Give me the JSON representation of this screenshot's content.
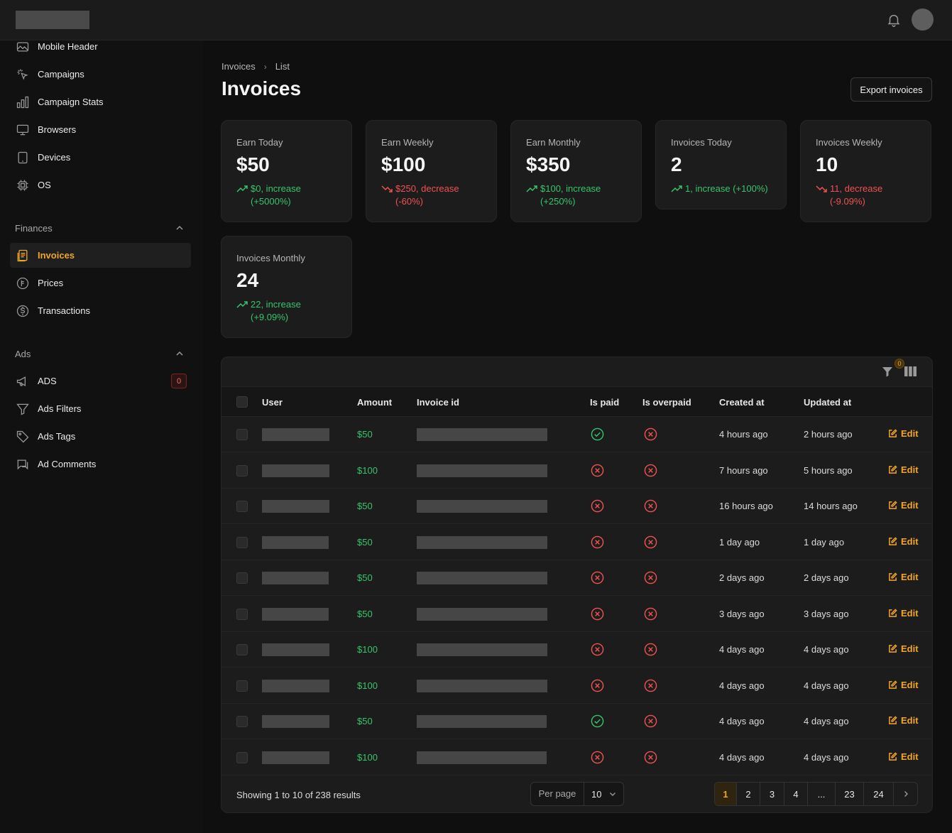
{
  "header": {
    "logo_alt": "",
    "bell_icon": "bell-icon",
    "avatar": "avatar"
  },
  "sidebar": {
    "items_top": [
      {
        "label": "Mobile Header",
        "icon": "image-icon"
      },
      {
        "label": "Campaigns",
        "icon": "pointer-click-icon"
      },
      {
        "label": "Campaign Stats",
        "icon": "bar-chart-icon"
      },
      {
        "label": "Browsers",
        "icon": "monitor-icon"
      },
      {
        "label": "Devices",
        "icon": "tablet-icon"
      },
      {
        "label": "OS",
        "icon": "chip-icon"
      }
    ],
    "finances": {
      "label": "Finances",
      "items": [
        {
          "label": "Invoices",
          "icon": "invoice-icon",
          "active": true
        },
        {
          "label": "Prices",
          "icon": "price-icon"
        },
        {
          "label": "Transactions",
          "icon": "dollar-icon"
        }
      ]
    },
    "ads": {
      "label": "Ads",
      "items": [
        {
          "label": "ADS",
          "icon": "megaphone-icon",
          "badge": "0"
        },
        {
          "label": "Ads Filters",
          "icon": "filter-icon"
        },
        {
          "label": "Ads Tags",
          "icon": "tag-icon"
        },
        {
          "label": "Ad Comments",
          "icon": "comment-icon"
        }
      ]
    }
  },
  "breadcrumb": {
    "root": "Invoices",
    "sep": "›",
    "current": "List"
  },
  "page": {
    "title": "Invoices",
    "export_label": "Export invoices"
  },
  "stats": [
    {
      "label": "Earn Today",
      "value": "$50",
      "trend": "up",
      "text": "$0, increase (+5000%)"
    },
    {
      "label": "Earn Weekly",
      "value": "$100",
      "trend": "down",
      "text": "$250, decrease (-60%)"
    },
    {
      "label": "Earn Monthly",
      "value": "$350",
      "trend": "up",
      "text": "$100, increase (+250%)"
    },
    {
      "label": "Invoices Today",
      "value": "2",
      "trend": "up",
      "text": "1, increase (+100%)"
    },
    {
      "label": "Invoices Weekly",
      "value": "10",
      "trend": "down",
      "text": "11, decrease (-9.09%)"
    },
    {
      "label": "Invoices Monthly",
      "value": "24",
      "trend": "up",
      "text": "22, increase (+9.09%)"
    }
  ],
  "table": {
    "filter_count": "0",
    "columns": [
      "User",
      "Amount",
      "Invoice id",
      "Is paid",
      "Is overpaid",
      "Created at",
      "Updated at"
    ],
    "edit_label": "Edit",
    "rows": [
      {
        "amount": "$50",
        "paid": true,
        "overpaid": false,
        "created": "4 hours ago",
        "updated": "2 hours ago"
      },
      {
        "amount": "$100",
        "paid": false,
        "overpaid": false,
        "created": "7 hours ago",
        "updated": "5 hours ago"
      },
      {
        "amount": "$50",
        "paid": false,
        "overpaid": false,
        "created": "16 hours ago",
        "updated": "14 hours ago"
      },
      {
        "amount": "$50",
        "paid": false,
        "overpaid": false,
        "created": "1 day ago",
        "updated": "1 day ago"
      },
      {
        "amount": "$50",
        "paid": false,
        "overpaid": false,
        "created": "2 days ago",
        "updated": "2 days ago"
      },
      {
        "amount": "$50",
        "paid": false,
        "overpaid": false,
        "created": "3 days ago",
        "updated": "3 days ago"
      },
      {
        "amount": "$100",
        "paid": false,
        "overpaid": false,
        "created": "4 days ago",
        "updated": "4 days ago"
      },
      {
        "amount": "$100",
        "paid": false,
        "overpaid": false,
        "created": "4 days ago",
        "updated": "4 days ago"
      },
      {
        "amount": "$50",
        "paid": true,
        "overpaid": false,
        "created": "4 days ago",
        "updated": "4 days ago"
      },
      {
        "amount": "$100",
        "paid": false,
        "overpaid": false,
        "created": "4 days ago",
        "updated": "4 days ago"
      }
    ],
    "footer": {
      "showing": "Showing 1 to 10 of 238 results",
      "per_page_label": "Per page",
      "per_page_value": "10",
      "pages": [
        "1",
        "2",
        "3",
        "4",
        "...",
        "23",
        "24"
      ],
      "current_page": "1"
    }
  },
  "colors": {
    "accent": "#f3a526",
    "success": "#37c46c",
    "danger": "#f05252",
    "bg": "#0f0f0f",
    "panel": "#1c1c1c"
  }
}
